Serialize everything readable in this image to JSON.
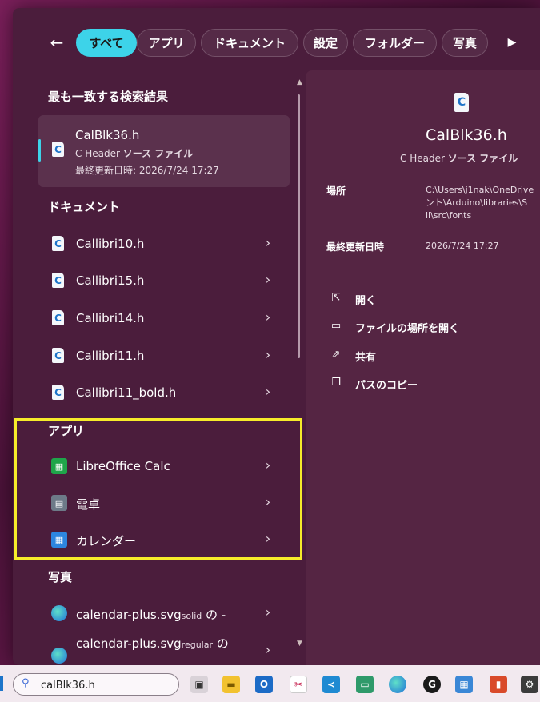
{
  "filters": {
    "back": "←",
    "chips": [
      "すべて",
      "アプリ",
      "ドキュメント",
      "設定",
      "フォルダー",
      "写真"
    ],
    "more": "▶"
  },
  "best_match": {
    "section": "最も一致する検索結果",
    "name": "CalBlk36.h",
    "type_prefix": "C Header ",
    "type_bold": "ソース ファイル",
    "date_label": "最終更新日時: ",
    "date_value": "2026/7/24 17:27",
    "icon": "c-file-icon"
  },
  "documents": {
    "section": "ドキュメント",
    "items": [
      "Callibri10.h",
      "Callibri15.h",
      "Callibri14.h",
      "Callibri11.h",
      "Callibri11_bold.h"
    ]
  },
  "apps": {
    "section": "アプリ",
    "items": [
      {
        "label": "LibreOffice Calc",
        "icon": "libreoffice-calc-icon"
      },
      {
        "label": "電卓",
        "icon": "calculator-icon"
      },
      {
        "label": "カレンダー",
        "icon": "calendar-icon"
      }
    ]
  },
  "photos": {
    "section": "写真",
    "items": [
      {
        "label": "calendar-plus.svg",
        "suffix_small": "solid",
        "suffix": " の -"
      },
      {
        "label": "calendar-plus.svg",
        "suffix_small": "regular",
        "suffix": " の"
      }
    ]
  },
  "details": {
    "title": "CalBlk36.h",
    "type_prefix": "C Header ",
    "type_bold": "ソース ファイル",
    "location_label": "場所",
    "location_lines": [
      "C:\\Users\\j1nak\\OneDrive",
      "ント\\Arduino\\libraries\\S",
      "ii\\src\\fonts"
    ],
    "modified_label": "最終更新日時",
    "modified_value": "2026/7/24 17:27",
    "actions": [
      {
        "label": "開く",
        "icon": "open-external-icon"
      },
      {
        "label": "ファイルの場所を開く",
        "icon": "folder-icon"
      },
      {
        "label": "共有",
        "icon": "share-icon"
      },
      {
        "label": "パスのコピー",
        "icon": "copy-icon"
      }
    ]
  },
  "taskbar": {
    "search_value": "calBlk36.h",
    "icons": [
      "task-view-icon",
      "file-explorer-icon",
      "outlook-icon",
      "snipping-tool-icon",
      "vscode-icon",
      "remote-desktop-icon",
      "edge-icon",
      "logitech-icon",
      "control-panel-icon",
      "app-icon",
      "settings-icon"
    ]
  },
  "colors": {
    "accent": "#3dd3e9",
    "highlight_box": "#f6ec2a",
    "panel": "#4b1d3c"
  }
}
